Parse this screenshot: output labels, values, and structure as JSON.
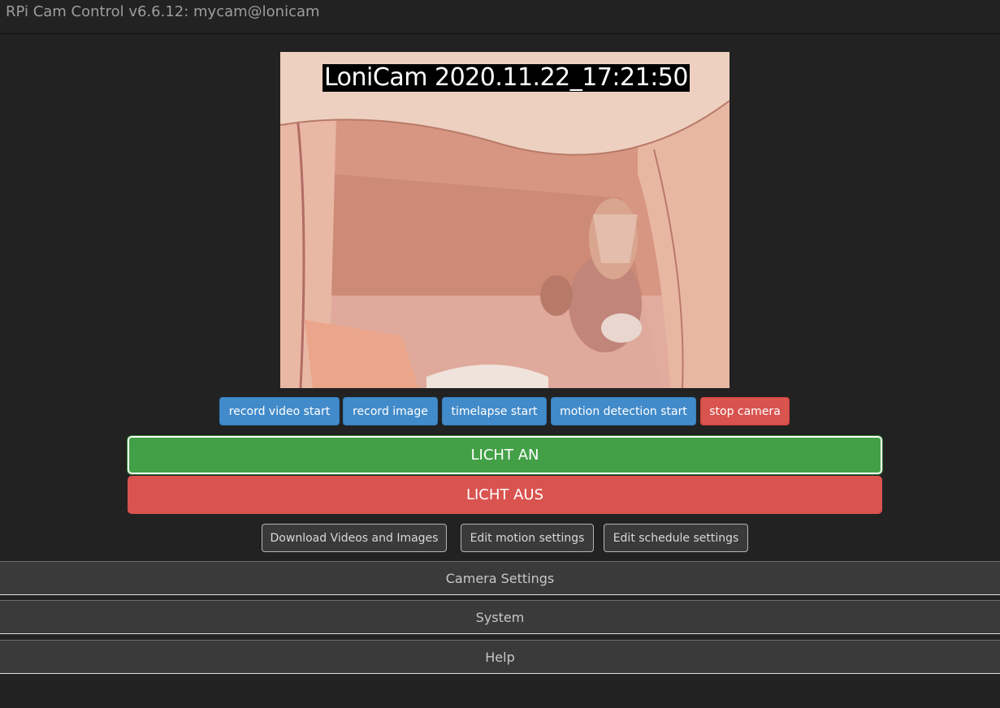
{
  "app": {
    "title": "RPi Cam Control v6.6.12: mycam@lonicam"
  },
  "preview": {
    "overlay_text": "LoniCam  2020.11.22_17:21:50",
    "scene_colors": {
      "background": "#d99a84",
      "canopy": "#e8c2b0",
      "shadow": "#9e5c4c"
    }
  },
  "controls": {
    "record_video": "record video start",
    "record_image": "record image",
    "timelapse": "timelapse start",
    "motion_detection": "motion detection start",
    "stop_camera": "stop camera"
  },
  "macros": {
    "light_on": "LICHT AN",
    "light_off": "LICHT AUS"
  },
  "links": {
    "download": "Download Videos and Images",
    "edit_motion": "Edit motion settings",
    "edit_schedule": "Edit schedule settings"
  },
  "panels": {
    "camera_settings": "Camera Settings",
    "system": "System",
    "help": "Help"
  },
  "colors": {
    "page_bg": "#222222",
    "primary": "#428bca",
    "danger": "#d9534f",
    "success": "#43a047"
  }
}
